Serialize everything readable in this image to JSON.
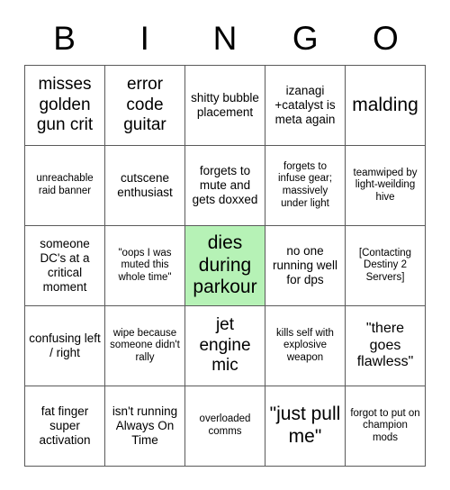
{
  "header": {
    "letters": [
      "B",
      "I",
      "N",
      "G",
      "O"
    ]
  },
  "colors": {
    "marked_cell": "#b6f2b6",
    "grid_border": "#5a5a5a",
    "text": "#000000",
    "background": "#ffffff"
  },
  "board": {
    "rows": [
      [
        {
          "text": "misses golden gun crit",
          "size": "lg",
          "marked": false
        },
        {
          "text": "error code guitar",
          "size": "lg",
          "marked": false
        },
        {
          "text": "shitty bubble placement",
          "size": "sm",
          "marked": false
        },
        {
          "text": "izanagi +catalyst is meta again",
          "size": "sm",
          "marked": false
        },
        {
          "text": "malding",
          "size": "xl",
          "marked": false
        }
      ],
      [
        {
          "text": "unreachable raid banner",
          "size": "xs",
          "marked": false
        },
        {
          "text": "cutscene enthusiast",
          "size": "sm",
          "marked": false
        },
        {
          "text": "forgets to mute and gets doxxed",
          "size": "sm",
          "marked": false
        },
        {
          "text": "forgets to infuse gear; massively under light",
          "size": "xs",
          "marked": false
        },
        {
          "text": "teamwiped by light-weilding hive",
          "size": "xs",
          "marked": false
        }
      ],
      [
        {
          "text": "someone DC's at a critical moment",
          "size": "sm",
          "marked": false
        },
        {
          "text": "\"oops I was muted this whole time\"",
          "size": "xs",
          "marked": false
        },
        {
          "text": "dies during parkour",
          "size": "xl",
          "marked": true
        },
        {
          "text": "no one running well for dps",
          "size": "sm",
          "marked": false
        },
        {
          "text": "[Contacting Destiny 2 Servers]",
          "size": "xs",
          "marked": false
        }
      ],
      [
        {
          "text": "confusing left / right",
          "size": "sm",
          "marked": false
        },
        {
          "text": "wipe because someone didn't rally",
          "size": "xs",
          "marked": false
        },
        {
          "text": "jet engine mic",
          "size": "lg",
          "marked": false
        },
        {
          "text": "kills self with explosive weapon",
          "size": "xs",
          "marked": false
        },
        {
          "text": "\"there goes flawless\"",
          "size": "md",
          "marked": false
        }
      ],
      [
        {
          "text": "fat finger super activation",
          "size": "sm",
          "marked": false
        },
        {
          "text": "isn't running Always On Time",
          "size": "sm",
          "marked": false
        },
        {
          "text": "overloaded comms",
          "size": "xs",
          "marked": false
        },
        {
          "text": "\"just pull me\"",
          "size": "xl",
          "marked": false
        },
        {
          "text": "forgot to put on champion mods",
          "size": "xs",
          "marked": false
        }
      ]
    ]
  }
}
